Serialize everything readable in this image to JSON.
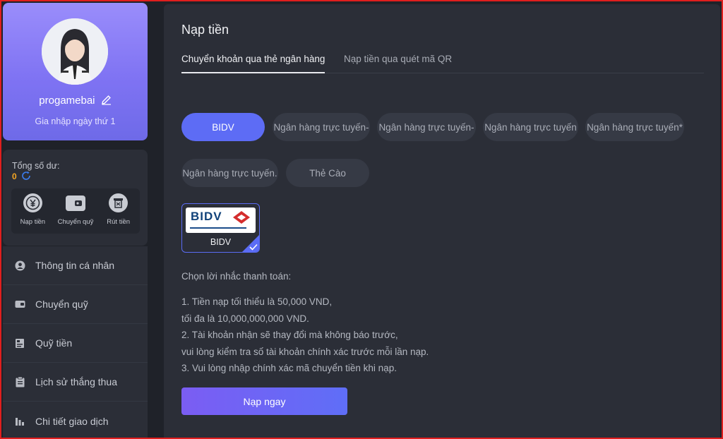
{
  "profile": {
    "username": "progamebai",
    "joined": "Gia nhập ngày thứ 1"
  },
  "balance": {
    "label": "Tổng số dư:",
    "value": "0"
  },
  "quick_actions": [
    {
      "label": "Nạp tiền",
      "icon": "yen-coin-icon"
    },
    {
      "label": "Chuyển quỹ",
      "icon": "wallet-icon"
    },
    {
      "label": "Rút tiền",
      "icon": "atm-withdraw-icon"
    }
  ],
  "menu": [
    {
      "label": "Thông tin cá nhân",
      "icon": "user-icon"
    },
    {
      "label": "Chuyển quỹ",
      "icon": "wallet-icon"
    },
    {
      "label": "Quỹ tiền",
      "icon": "fund-icon"
    },
    {
      "label": "Lịch sử thắng thua",
      "icon": "clipboard-icon"
    },
    {
      "label": "Chi tiết giao dịch",
      "icon": "bar-chart-icon"
    }
  ],
  "main": {
    "title": "Nạp tiền",
    "tabs": [
      {
        "label": "Chuyển khoản qua thẻ ngân hàng",
        "active": true
      },
      {
        "label": "Nạp tiền qua quét mã QR",
        "active": false
      }
    ],
    "banks": [
      {
        "label": "BIDV",
        "active": true
      },
      {
        "label": "Ngân hàng trực tuyến-"
      },
      {
        "label": "Ngân hàng trực tuyến-"
      },
      {
        "label": "Ngân hàng trực tuyến"
      },
      {
        "label": "Ngân hàng trực tuyến*"
      },
      {
        "label": "Ngân hàng trực tuyến."
      },
      {
        "label": "Thẻ Cào"
      }
    ],
    "selected_bank": {
      "logo_text": "BIDV",
      "label": "BIDV"
    },
    "reminder_title": "Chọn lời nhắc thanh toán:",
    "notes": [
      "1. Tiền nạp tối thiểu là 50,000 VND,",
      "tối đa là 10,000,000,000 VND.",
      "2. Tài khoản nhận sẽ thay đổi mà không báo trước,",
      "vui lòng kiểm tra số tài khoản chính xác trước mỗi lần nạp.",
      "3. Vui lòng nhập chính xác mã chuyển tiền khi nạp."
    ],
    "submit_label": "Nạp ngay"
  },
  "colors": {
    "accent": "#5d6cf5",
    "balance": "#f5a623",
    "frame": "#e01e1e"
  }
}
